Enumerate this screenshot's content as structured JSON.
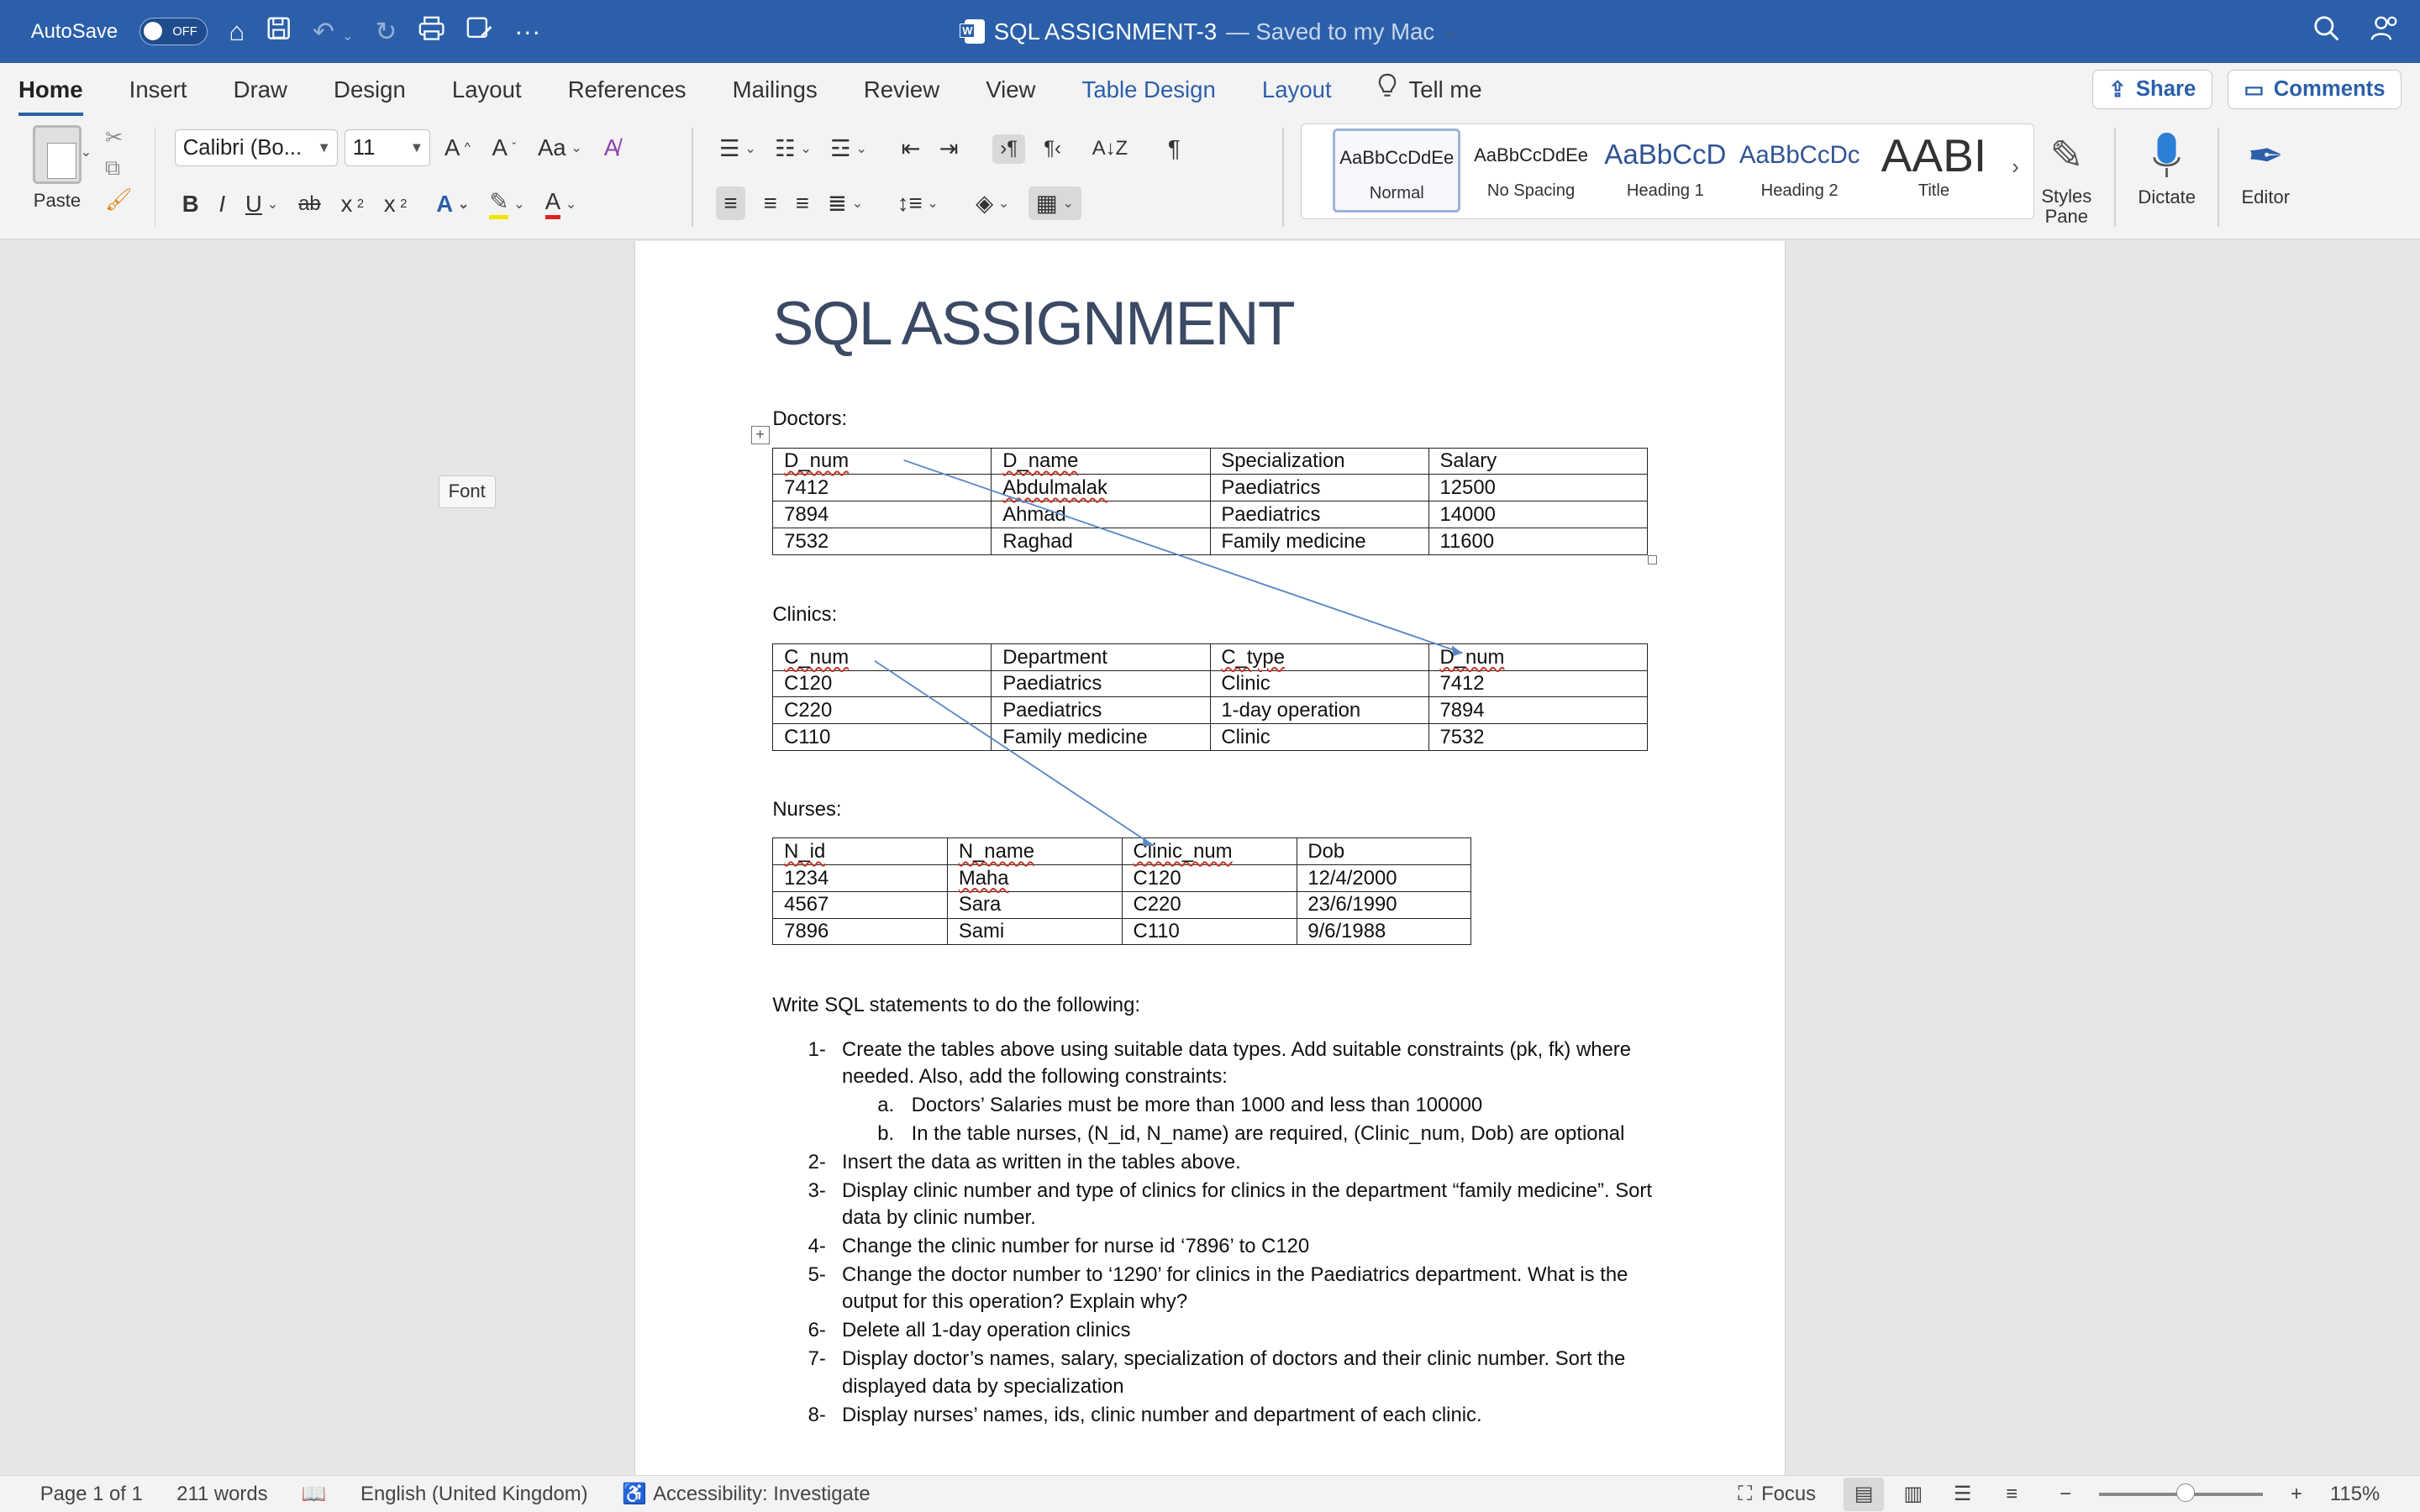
{
  "titlebar": {
    "autosave_label": "AutoSave",
    "autosave_state": "OFF",
    "doc_name": "SQL ASSIGNMENT-3",
    "save_status": "— Saved to my Mac"
  },
  "ribbon_tabs": [
    "Home",
    "Insert",
    "Draw",
    "Design",
    "Layout",
    "References",
    "Mailings",
    "Review",
    "View",
    "Table Design",
    "Layout"
  ],
  "tell_me": "Tell me",
  "share_label": "Share",
  "comments_label": "Comments",
  "ribbon": {
    "paste_label": "Paste",
    "font_name": "Calibri (Bo...",
    "font_size": "11",
    "styles": [
      {
        "preview": "AaBbCcDdEe",
        "name": "Normal"
      },
      {
        "preview": "AaBbCcDdEe",
        "name": "No Spacing"
      },
      {
        "preview": "AaBbCcD",
        "name": "Heading 1"
      },
      {
        "preview": "AaBbCcDc",
        "name": "Heading 2"
      },
      {
        "preview": "AABI",
        "name": "Title"
      }
    ],
    "styles_pane_label": "Styles Pane",
    "dictate_label": "Dictate",
    "editor_label": "Editor"
  },
  "tooltip": "Font",
  "document": {
    "title": "SQL ASSIGNMENT",
    "doctors_label": "Doctors:",
    "doctors_table": [
      [
        "D_num",
        "D_name",
        "Specialization",
        "Salary"
      ],
      [
        "7412",
        "Abdulmalak",
        "Paediatrics",
        "12500"
      ],
      [
        "7894",
        "Ahmad",
        "Paediatrics",
        "14000"
      ],
      [
        "7532",
        "Raghad",
        "Family medicine",
        "11600"
      ]
    ],
    "clinics_label": "Clinics:",
    "clinics_table": [
      [
        "C_num",
        "Department",
        "C_type",
        "D_num"
      ],
      [
        "C120",
        "Paediatrics",
        "Clinic",
        "7412"
      ],
      [
        "C220",
        "Paediatrics",
        "1-day operation",
        "7894"
      ],
      [
        "C110",
        "Family medicine",
        "Clinic",
        "7532"
      ]
    ],
    "nurses_label": "Nurses:",
    "nurses_table": [
      [
        "N_id",
        "N_name",
        "Clinic_num",
        "Dob"
      ],
      [
        "1234",
        "Maha",
        "C120",
        "12/4/2000"
      ],
      [
        "4567",
        "Sara",
        "C220",
        "23/6/1990"
      ],
      [
        "7896",
        "Sami",
        "C110",
        "9/6/1988"
      ]
    ],
    "instructions": "Write SQL statements to do the following:",
    "questions": [
      {
        "num": "1-",
        "text": "Create the tables above using suitable data types. Add suitable constraints (pk, fk) where needed. Also, add the following constraints:",
        "sub": [
          {
            "num": "a.",
            "text": "Doctors’ Salaries must be more than 1000 and less than 100000"
          },
          {
            "num": "b.",
            "text": "In the table nurses, (N_id, N_name) are required, (Clinic_num, Dob) are optional"
          }
        ]
      },
      {
        "num": "2-",
        "text": "Insert the data as written in the tables above."
      },
      {
        "num": "3-",
        "text": "Display clinic number and type of clinics for clinics in the department “family medicine”. Sort data by clinic number."
      },
      {
        "num": "4-",
        "text": "Change the clinic number for nurse id ‘7896’ to C120"
      },
      {
        "num": "5-",
        "text": "Change the doctor number to ‘1290’ for clinics in the Paediatrics department. What is the output for this operation? Explain why?"
      },
      {
        "num": "6-",
        "text": "Delete all 1-day operation clinics"
      },
      {
        "num": "7-",
        "text": "Display doctor’s names, salary, specialization of doctors and their clinic number. Sort the displayed data by specialization"
      },
      {
        "num": "8-",
        "text": "Display nurses’ names, ids, clinic number and department of each clinic."
      }
    ]
  },
  "status": {
    "page": "Page 1 of 1",
    "words": "211 words",
    "language": "English (United Kingdom)",
    "accessibility": "Accessibility: Investigate",
    "focus": "Focus",
    "zoom": "115%",
    "zoom_level_percent": 115
  }
}
